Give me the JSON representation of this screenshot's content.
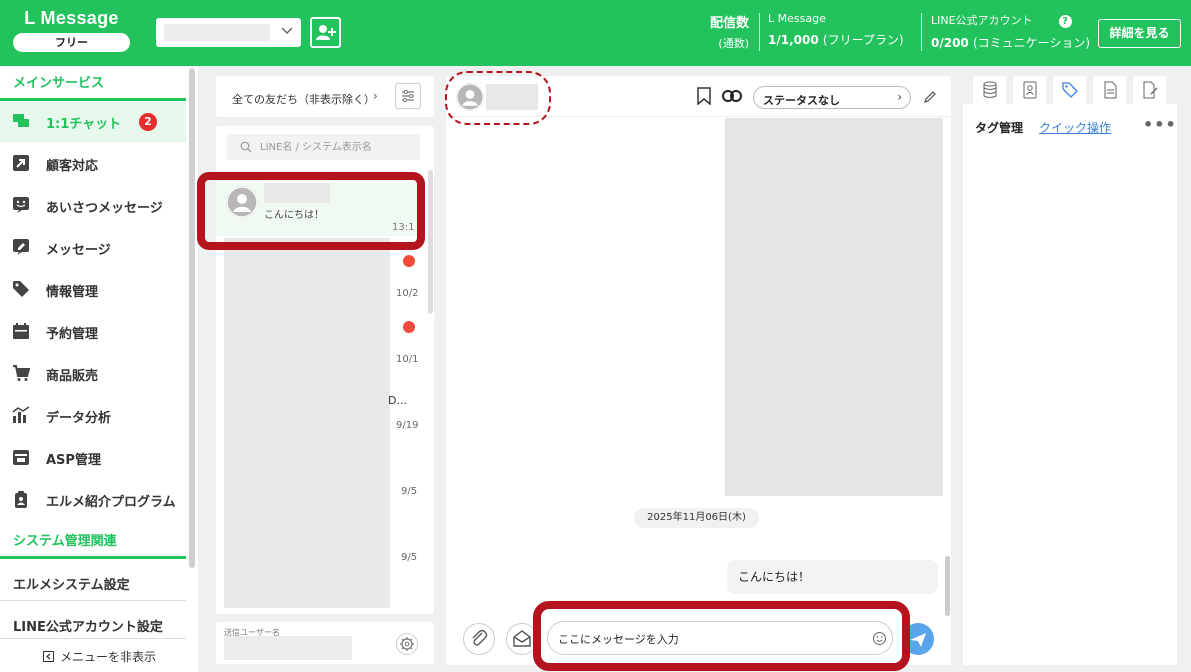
{
  "header": {
    "brand": "L Message",
    "plan": "フリー",
    "stat1_label": "配信数",
    "stat1_sub": "(通数)",
    "stat2_label": "L Message",
    "stat2_value": "1/1,000",
    "stat2_plan": "(フリープラン)",
    "stat3_label": "LINE公式アカウント",
    "stat3_value": "0/200",
    "stat3_plan": "(コミュニケーション)",
    "help": "?",
    "details_button": "詳細を見る"
  },
  "sidebar": {
    "section_main": "メインサービス",
    "items": [
      {
        "label": "1:1チャット",
        "badge": "2"
      },
      {
        "label": "顧客対応"
      },
      {
        "label": "あいさつメッセージ"
      },
      {
        "label": "メッセージ"
      },
      {
        "label": "情報管理"
      },
      {
        "label": "予約管理"
      },
      {
        "label": "商品販売"
      },
      {
        "label": "データ分析"
      },
      {
        "label": "ASP管理"
      },
      {
        "label": "エルメ紹介プログラム"
      }
    ],
    "section_system": "システム管理関連",
    "links": [
      "エルメシステム設定",
      "LINE公式アカウント設定"
    ],
    "hide_menu": "メニューを非表示"
  },
  "friends": {
    "filter": "全ての友だち（非表示除く）",
    "filter_arrow": "›",
    "search_placeholder": "LINE名 / システム表示名",
    "selected": {
      "message": "こんにちは！",
      "time": "13:1"
    },
    "dates": [
      "10/2",
      "10/1",
      "9/19",
      "9/5",
      "9/5"
    ],
    "truncated": "D..."
  },
  "sender": {
    "label": "送信ユーザー名"
  },
  "chat": {
    "status": "ステータスなし",
    "status_arrow": "›",
    "date": "2025年11月06日(木)",
    "bubble": "こんにちは！",
    "input_value": "ここにメッセージを入力"
  },
  "right_panel": {
    "tag_title": "タグ管理",
    "quick": "クイック操作",
    "more": "•••"
  },
  "colors": {
    "brand_green": "#22c25c",
    "badge_red": "#e62d2d",
    "annotation_red": "#b3141e",
    "send_blue": "#5aa4ec",
    "link_blue": "#3b7fd9"
  }
}
